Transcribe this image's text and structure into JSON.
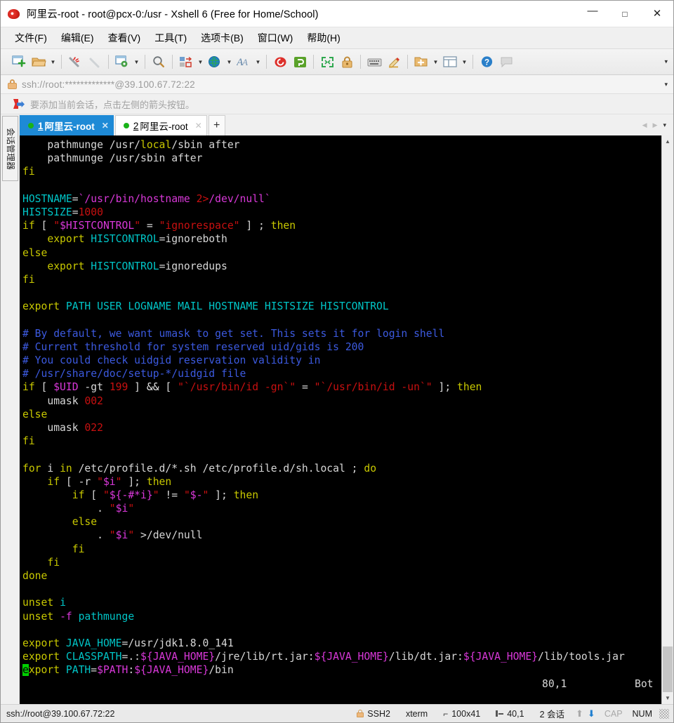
{
  "window": {
    "title": "阿里云-root - root@pcx-0:/usr - Xshell 6 (Free for Home/School)",
    "app_icon": "xshell-logo-icon",
    "minimize": "—",
    "maximize": "□",
    "close": "✕"
  },
  "menubar": {
    "items": [
      {
        "label": "文件(F)",
        "name": "menu-file"
      },
      {
        "label": "编辑(E)",
        "name": "menu-edit"
      },
      {
        "label": "查看(V)",
        "name": "menu-view"
      },
      {
        "label": "工具(T)",
        "name": "menu-tools"
      },
      {
        "label": "选项卡(B)",
        "name": "menu-tabs"
      },
      {
        "label": "窗口(W)",
        "name": "menu-window"
      },
      {
        "label": "帮助(H)",
        "name": "menu-help"
      }
    ]
  },
  "toolbar": {
    "overflow_caret": "▾",
    "buttons": [
      "new-session-icon",
      "open-folder-icon",
      "reconnect-icon",
      "disconnect-icon",
      "session-properties-icon",
      "find-icon",
      "transfer-file-icon",
      "web-browser-icon",
      "font-icon",
      "xshell-logo-icon",
      "xftp-icon",
      "fullscreen-icon",
      "lock-icon",
      "keyboard-icon",
      "highlight-edit-icon",
      "add-to-folder-icon",
      "layout-icon",
      "help-icon",
      "chat-icon"
    ]
  },
  "address_bar": {
    "lock_icon": "lock-icon",
    "url": "ssh://root:*************@39.100.67.72:22",
    "dropdown_caret": "▾"
  },
  "notice_bar": {
    "icon": "flag-arrow-icon",
    "text": "要添加当前会话，点击左侧的箭头按钮。"
  },
  "side_panel": {
    "label": "会话管理器"
  },
  "tabs": {
    "items": [
      {
        "number": "1",
        "label": "阿里云-root",
        "active": true,
        "close": "✕",
        "status_dot": "connected"
      },
      {
        "number": "2",
        "label": "阿里云-root",
        "active": false,
        "close": "✕",
        "status_dot": "connected"
      }
    ],
    "new_tab": "+",
    "nav_prev": "◀",
    "nav_next": "▶",
    "nav_list": "▾"
  },
  "terminal": {
    "background": "#000000",
    "colors": {
      "default": "#d7d7d7",
      "keyword": "#c8c800",
      "variable": "#00c5c7",
      "string_magenta": "#d938d9",
      "number_red": "#c81010",
      "comment_blue": "#3c5ae0",
      "cursor": "#00d000"
    },
    "vim_status": {
      "position": "80,1",
      "scroll": "Bot"
    },
    "lines": [
      [
        {
          "t": "    pathmunge /usr/",
          "c": "c-def"
        },
        {
          "t": "local",
          "c": "c-yel"
        },
        {
          "t": "/sbin after",
          "c": "c-def"
        }
      ],
      [
        {
          "t": "    pathmunge /usr/sbin after",
          "c": "c-def"
        }
      ],
      [
        {
          "t": "fi",
          "c": "c-yel"
        }
      ],
      [
        {
          "t": "",
          "c": "c-def"
        }
      ],
      [
        {
          "t": "HOSTNAME",
          "c": "c-cyan"
        },
        {
          "t": "=",
          "c": "c-def"
        },
        {
          "t": "`/usr/bin/hostname ",
          "c": "c-mag"
        },
        {
          "t": "2>",
          "c": "c-red"
        },
        {
          "t": "/dev/null`",
          "c": "c-mag"
        }
      ],
      [
        {
          "t": "HISTSIZE",
          "c": "c-cyan"
        },
        {
          "t": "=",
          "c": "c-def"
        },
        {
          "t": "1000",
          "c": "c-red"
        }
      ],
      [
        {
          "t": "if",
          "c": "c-yel"
        },
        {
          "t": " [ ",
          "c": "c-def"
        },
        {
          "t": "\"",
          "c": "c-red"
        },
        {
          "t": "$HISTCONTROL",
          "c": "c-mag"
        },
        {
          "t": "\"",
          "c": "c-red"
        },
        {
          "t": " = ",
          "c": "c-def"
        },
        {
          "t": "\"ignorespace\"",
          "c": "c-red"
        },
        {
          "t": " ] ; ",
          "c": "c-def"
        },
        {
          "t": "then",
          "c": "c-yel"
        }
      ],
      [
        {
          "t": "    ",
          "c": "c-def"
        },
        {
          "t": "export",
          "c": "c-yel"
        },
        {
          "t": " ",
          "c": "c-def"
        },
        {
          "t": "HISTCONTROL",
          "c": "c-cyan"
        },
        {
          "t": "=ignoreboth",
          "c": "c-def"
        }
      ],
      [
        {
          "t": "else",
          "c": "c-yel"
        }
      ],
      [
        {
          "t": "    ",
          "c": "c-def"
        },
        {
          "t": "export",
          "c": "c-yel"
        },
        {
          "t": " ",
          "c": "c-def"
        },
        {
          "t": "HISTCONTROL",
          "c": "c-cyan"
        },
        {
          "t": "=ignoredups",
          "c": "c-def"
        }
      ],
      [
        {
          "t": "fi",
          "c": "c-yel"
        }
      ],
      [
        {
          "t": "",
          "c": "c-def"
        }
      ],
      [
        {
          "t": "export",
          "c": "c-yel"
        },
        {
          "t": " ",
          "c": "c-def"
        },
        {
          "t": "PATH USER LOGNAME MAIL HOSTNAME HISTSIZE HISTCONTROL",
          "c": "c-cyan"
        }
      ],
      [
        {
          "t": "",
          "c": "c-def"
        }
      ],
      [
        {
          "t": "# By default, we want umask to get set. This sets it for login shell",
          "c": "c-blue"
        }
      ],
      [
        {
          "t": "# Current threshold for system reserved uid/gids is 200",
          "c": "c-blue"
        }
      ],
      [
        {
          "t": "# You could check uidgid reservation validity in",
          "c": "c-blue"
        }
      ],
      [
        {
          "t": "# /usr/share/doc/setup-*/uidgid file",
          "c": "c-blue"
        }
      ],
      [
        {
          "t": "if",
          "c": "c-yel"
        },
        {
          "t": " [ ",
          "c": "c-def"
        },
        {
          "t": "$UID",
          "c": "c-mag"
        },
        {
          "t": " -gt ",
          "c": "c-def"
        },
        {
          "t": "199",
          "c": "c-red"
        },
        {
          "t": " ] ",
          "c": "c-def"
        },
        {
          "t": "&&",
          "c": "c-white"
        },
        {
          "t": " [ ",
          "c": "c-def"
        },
        {
          "t": "\"`/usr/bin/id -gn`\"",
          "c": "c-red"
        },
        {
          "t": " = ",
          "c": "c-def"
        },
        {
          "t": "\"`/usr/bin/id -un`\"",
          "c": "c-red"
        },
        {
          "t": " ]; ",
          "c": "c-def"
        },
        {
          "t": "then",
          "c": "c-yel"
        }
      ],
      [
        {
          "t": "    umask ",
          "c": "c-def"
        },
        {
          "t": "002",
          "c": "c-red"
        }
      ],
      [
        {
          "t": "else",
          "c": "c-yel"
        }
      ],
      [
        {
          "t": "    umask ",
          "c": "c-def"
        },
        {
          "t": "022",
          "c": "c-red"
        }
      ],
      [
        {
          "t": "fi",
          "c": "c-yel"
        }
      ],
      [
        {
          "t": "",
          "c": "c-def"
        }
      ],
      [
        {
          "t": "for",
          "c": "c-yel"
        },
        {
          "t": " i ",
          "c": "c-def"
        },
        {
          "t": "in",
          "c": "c-yel"
        },
        {
          "t": " /etc/profile.d/*.sh /etc/profile.d/sh.local ; ",
          "c": "c-def"
        },
        {
          "t": "do",
          "c": "c-yel"
        }
      ],
      [
        {
          "t": "    ",
          "c": "c-def"
        },
        {
          "t": "if",
          "c": "c-yel"
        },
        {
          "t": " [ -r ",
          "c": "c-def"
        },
        {
          "t": "\"",
          "c": "c-red"
        },
        {
          "t": "$i",
          "c": "c-mag"
        },
        {
          "t": "\"",
          "c": "c-red"
        },
        {
          "t": " ]; ",
          "c": "c-def"
        },
        {
          "t": "then",
          "c": "c-yel"
        }
      ],
      [
        {
          "t": "        ",
          "c": "c-def"
        },
        {
          "t": "if",
          "c": "c-yel"
        },
        {
          "t": " [ ",
          "c": "c-def"
        },
        {
          "t": "\"",
          "c": "c-red"
        },
        {
          "t": "${-#*i}",
          "c": "c-mag"
        },
        {
          "t": "\"",
          "c": "c-red"
        },
        {
          "t": " != ",
          "c": "c-def"
        },
        {
          "t": "\"",
          "c": "c-red"
        },
        {
          "t": "$-",
          "c": "c-mag"
        },
        {
          "t": "\"",
          "c": "c-red"
        },
        {
          "t": " ]; ",
          "c": "c-def"
        },
        {
          "t": "then",
          "c": "c-yel"
        }
      ],
      [
        {
          "t": "            . ",
          "c": "c-def"
        },
        {
          "t": "\"",
          "c": "c-red"
        },
        {
          "t": "$i",
          "c": "c-mag"
        },
        {
          "t": "\"",
          "c": "c-red"
        }
      ],
      [
        {
          "t": "        ",
          "c": "c-def"
        },
        {
          "t": "else",
          "c": "c-yel"
        }
      ],
      [
        {
          "t": "            . ",
          "c": "c-def"
        },
        {
          "t": "\"",
          "c": "c-red"
        },
        {
          "t": "$i",
          "c": "c-mag"
        },
        {
          "t": "\"",
          "c": "c-red"
        },
        {
          "t": " >/dev/null",
          "c": "c-def"
        }
      ],
      [
        {
          "t": "        ",
          "c": "c-def"
        },
        {
          "t": "fi",
          "c": "c-yel"
        }
      ],
      [
        {
          "t": "    ",
          "c": "c-def"
        },
        {
          "t": "fi",
          "c": "c-yel"
        }
      ],
      [
        {
          "t": "done",
          "c": "c-yel"
        }
      ],
      [
        {
          "t": "",
          "c": "c-def"
        }
      ],
      [
        {
          "t": "unset",
          "c": "c-yel"
        },
        {
          "t": " ",
          "c": "c-def"
        },
        {
          "t": "i",
          "c": "c-cyan"
        }
      ],
      [
        {
          "t": "unset",
          "c": "c-yel"
        },
        {
          "t": " ",
          "c": "c-def"
        },
        {
          "t": "-f",
          "c": "c-mag"
        },
        {
          "t": " ",
          "c": "c-def"
        },
        {
          "t": "pathmunge",
          "c": "c-cyan"
        }
      ],
      [
        {
          "t": "",
          "c": "c-def"
        }
      ],
      [
        {
          "t": "export",
          "c": "c-yel"
        },
        {
          "t": " ",
          "c": "c-def"
        },
        {
          "t": "JAVA_HOME",
          "c": "c-cyan"
        },
        {
          "t": "=/usr/jdk1.8.0_141",
          "c": "c-def"
        }
      ],
      [
        {
          "t": "export",
          "c": "c-yel"
        },
        {
          "t": " ",
          "c": "c-def"
        },
        {
          "t": "CLASSPATH",
          "c": "c-cyan"
        },
        {
          "t": "=.:",
          "c": "c-def"
        },
        {
          "t": "${JAVA_HOME}",
          "c": "c-mag"
        },
        {
          "t": "/jre/lib/rt.jar:",
          "c": "c-def"
        },
        {
          "t": "${JAVA_HOME}",
          "c": "c-mag"
        },
        {
          "t": "/lib/dt.jar:",
          "c": "c-def"
        },
        {
          "t": "${JAVA_HOME}",
          "c": "c-mag"
        },
        {
          "t": "/lib/tools.jar",
          "c": "c-def"
        }
      ],
      [
        {
          "t": "e",
          "c": "cursor"
        },
        {
          "t": "xport",
          "c": "c-yel"
        },
        {
          "t": " ",
          "c": "c-def"
        },
        {
          "t": "PATH",
          "c": "c-cyan"
        },
        {
          "t": "=",
          "c": "c-def"
        },
        {
          "t": "$PATH",
          "c": "c-mag"
        },
        {
          "t": ":",
          "c": "c-def"
        },
        {
          "t": "${JAVA_HOME}",
          "c": "c-mag"
        },
        {
          "t": "/bin",
          "c": "c-def"
        }
      ]
    ]
  },
  "scrollbar": {
    "up": "▲",
    "down": "▼"
  },
  "statusbar": {
    "connection": "ssh://root@39.100.67.72:22",
    "protocol": "SSH2",
    "emulation": "xterm",
    "size": "100x41",
    "cursor_position": "40,1",
    "sessions": "2 会话",
    "upload_arrow": "⬆",
    "download_arrow": "⬇",
    "caps": "CAP",
    "num": "NUM"
  }
}
